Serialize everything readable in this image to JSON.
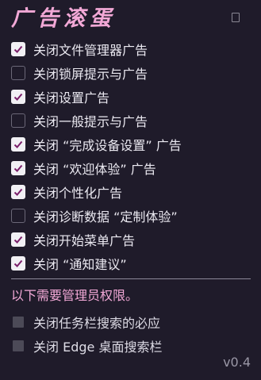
{
  "app": {
    "title": "广告滚蛋",
    "version": "v0.4"
  },
  "options": [
    {
      "label": "关闭文件管理器广告",
      "checked": true
    },
    {
      "label": "关闭锁屏提示与广告",
      "checked": false
    },
    {
      "label": "关闭设置广告",
      "checked": true
    },
    {
      "label": "关闭一般提示与广告",
      "checked": false
    },
    {
      "label": "关闭 “完成设备设置” 广告",
      "checked": true
    },
    {
      "label": "关闭 “欢迎体验” 广告",
      "checked": true
    },
    {
      "label": "关闭个性化广告",
      "checked": true
    },
    {
      "label": "关闭诊断数据 “定制体验”",
      "checked": false
    },
    {
      "label": "关闭开始菜单广告",
      "checked": true
    },
    {
      "label": "关闭 “通知建议”",
      "checked": true
    }
  ],
  "admin": {
    "note": "以下需要管理员权限。",
    "options": [
      {
        "label": "关闭任务栏搜索的必应",
        "checked": false,
        "enabled": false
      },
      {
        "label": "关闭 Edge 桌面搜索栏",
        "checked": false,
        "enabled": false
      }
    ]
  },
  "colors": {
    "background": "#1f1b2a",
    "accent": "#f2a8d6",
    "check_fill": "#f1f0f4",
    "text": "#ebe9f1",
    "muted": "#9a97a6"
  }
}
